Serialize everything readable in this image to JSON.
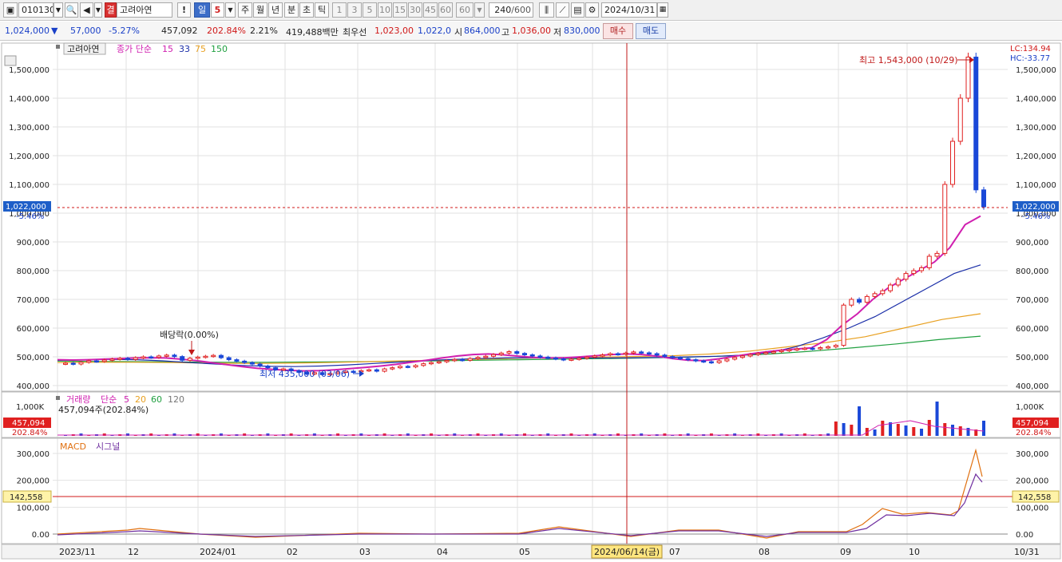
{
  "toolbar": {
    "code": "010130",
    "badge": "결",
    "name": "고려아연",
    "period_day": "일",
    "period_n": "5",
    "periods": [
      "주",
      "월",
      "년",
      "분",
      "초",
      "틱"
    ],
    "intervals": [
      "1",
      "3",
      "5",
      "10",
      "15",
      "30",
      "45",
      "60"
    ],
    "interval_sel": "60",
    "count": "240",
    "count_total": "/600",
    "date": "2024/10/31"
  },
  "quote": {
    "price": "1,024,000",
    "arrow": "▼",
    "change": "57,000",
    "change_pct": "-5.27%",
    "volume": "457,092",
    "volume_ratio": "202.84%",
    "turnover": "2.21%",
    "amount": "419,488백만",
    "best_label": "최우선",
    "best_ask": "1,023,00",
    "best_bid": "1,022,0",
    "open_label": "시",
    "open": "864,000",
    "high_label": "고",
    "high": "1,036,00",
    "low_label": "저",
    "low": "830,000",
    "buy_label": "매수",
    "sell_label": "매도"
  },
  "colors": {
    "up": "#e02020",
    "down": "#1a48d8",
    "ma15": "#d020b0",
    "ma33": "#1a2ea8",
    "ma75": "#e8a020",
    "ma150": "#20a040",
    "crosshair": "#c01818",
    "grid": "#e2e2e2"
  },
  "price_panel": {
    "legend_name": "고려아연",
    "legend_type": "종가 단순",
    "ma_periods": [
      "15",
      "33",
      "75",
      "150"
    ],
    "lc_label": "LC:134.94",
    "hc_label": "HC:-33.77",
    "y_ticks": [
      "1,500,000",
      "1,400,000",
      "1,300,000",
      "1,200,000",
      "1,100,000",
      "1,000,000",
      "900,000",
      "800,000",
      "700,000",
      "600,000",
      "500,000",
      "400,000"
    ],
    "current_price": "1,022,000",
    "current_pct": "-5.46%",
    "high_annot": "최고 1,543,000 (10/29)",
    "low_annot": "최저 435,000 (03/06)",
    "dividend_annot": "배당락(0.00%)"
  },
  "volume_panel": {
    "legend_name": "거래량",
    "legend_type": "단순",
    "ma_periods": [
      "5",
      "20",
      "60",
      "120"
    ],
    "sub_legend": "457,094주(202.84%)",
    "y_tick": "1,000K",
    "current": "457,094",
    "current_pct": "202.84%"
  },
  "macd_panel": {
    "legend_macd": "MACD",
    "legend_signal": "시그널",
    "y_ticks": [
      "300,000",
      "200,000",
      "100,000",
      "0.00"
    ],
    "current": "142,558"
  },
  "x_axis": {
    "labels": [
      "2023/11",
      "12",
      "2024/01",
      "02",
      "03",
      "04",
      "05",
      "06",
      "07",
      "08",
      "09",
      "10"
    ],
    "crosshair_date": "2024/06/14(금)",
    "end_label": "10/31"
  },
  "chart_data": {
    "type": "candlestick",
    "x_range": [
      "2023/11",
      "2024/10/31"
    ],
    "ylim": [
      400000,
      1550000
    ],
    "closes": [
      478000,
      475000,
      481000,
      486000,
      484000,
      489000,
      492000,
      495000,
      491000,
      497000,
      500000,
      498000,
      503000,
      506000,
      501000,
      488000,
      495000,
      499000,
      502000,
      505000,
      497000,
      490000,
      485000,
      480000,
      475000,
      468000,
      462000,
      455000,
      458000,
      452000,
      446000,
      440000,
      445000,
      438000,
      442000,
      447000,
      450000,
      448000,
      452000,
      455000,
      450000,
      458000,
      462000,
      467000,
      465000,
      470000,
      476000,
      480000,
      483000,
      487000,
      491000,
      488000,
      494000,
      498000,
      502000,
      508000,
      513000,
      518000,
      512000,
      507000,
      503000,
      499000,
      496000,
      493000,
      490000,
      492000,
      495000,
      499000,
      503000,
      507000,
      511000,
      509000,
      513000,
      517000,
      514000,
      511000,
      506000,
      501000,
      497000,
      494000,
      490000,
      486000,
      483000,
      480000,
      486000,
      492000,
      498000,
      503000,
      508000,
      512000,
      515000,
      518000,
      522000,
      525000,
      528000,
      530000,
      528000,
      532000,
      535000,
      540000,
      680000,
      700000,
      690000,
      710000,
      720000,
      730000,
      750000,
      770000,
      790000,
      800000,
      810000,
      850000,
      860000,
      1100000,
      1250000,
      1400000,
      1543000,
      1081000,
      1022000
    ],
    "ma15": [
      490000,
      489000,
      490000,
      492000,
      494000,
      496000,
      497000,
      496000,
      492000,
      487000,
      480000,
      473000,
      466000,
      460000,
      456000,
      453000,
      451000,
      452000,
      455000,
      459000,
      463000,
      468000,
      474000,
      481000,
      488000,
      496000,
      503000,
      508000,
      510000,
      507000,
      502000,
      498000,
      496000,
      497000,
      500000,
      504000,
      508000,
      510000,
      508000,
      502000,
      494000,
      488000,
      487000,
      493000,
      502000,
      510000,
      517000,
      523000,
      527000,
      531000,
      560000,
      610000,
      650000,
      700000,
      740000,
      770000,
      800000,
      830000,
      880000,
      960000,
      990000
    ],
    "ma33": [
      488000,
      490000,
      491000,
      490000,
      486000,
      480000,
      475000,
      470000,
      467000,
      466000,
      468000,
      472000,
      477000,
      482000,
      487000,
      491000,
      494000,
      496000,
      497000,
      497000,
      496000,
      496000,
      497000,
      498000,
      500000,
      502000,
      506000,
      515000,
      535000,
      565000,
      600000,
      640000,
      690000,
      740000,
      790000,
      820000
    ],
    "ma75": [
      480000,
      481000,
      481000,
      480000,
      478000,
      477000,
      478000,
      480000,
      483000,
      486000,
      489000,
      492000,
      495000,
      497000,
      499000,
      501000,
      504000,
      510000,
      520000,
      535000,
      550000,
      570000,
      600000,
      630000,
      650000
    ],
    "ma150": [
      485000,
      484000,
      483000,
      482000,
      481000,
      481000,
      482000,
      483000,
      484000,
      486000,
      488000,
      490000,
      492000,
      494000,
      496000,
      499000,
      503000,
      510000,
      520000,
      532000,
      545000,
      560000,
      572000
    ],
    "volume_ma_periods": [
      5,
      20,
      60,
      120
    ],
    "macd_signal_last": 142558,
    "macd_peak": 310000
  }
}
